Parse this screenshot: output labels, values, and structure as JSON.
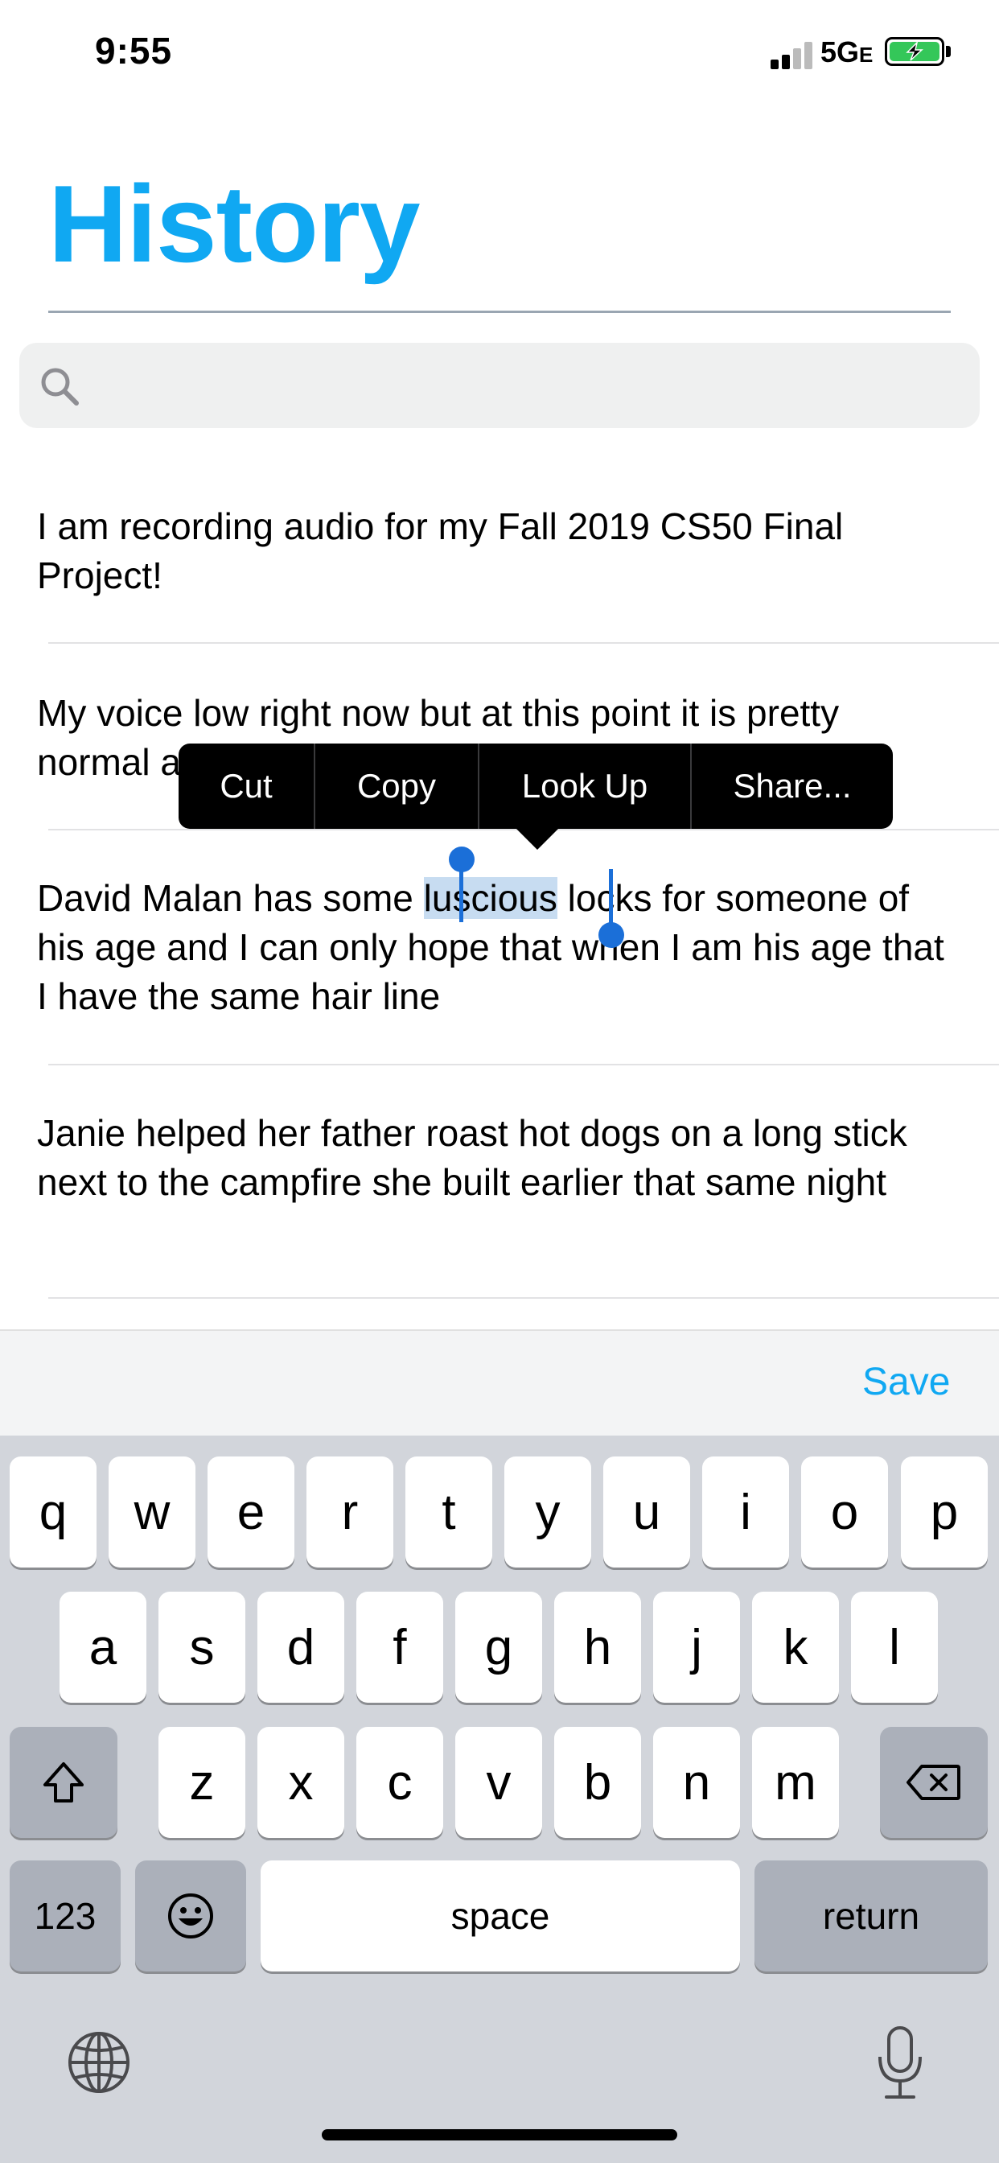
{
  "status_bar": {
    "time": "9:55",
    "network": "5G",
    "network_suffix": "E"
  },
  "header": {
    "title": "History"
  },
  "search": {
    "placeholder": ""
  },
  "entries": [
    {
      "text": "I am recording audio for my Fall 2019 CS50 Final Project!"
    },
    {
      "text": "My voice low right now but at this point it is pretty normal a"
    },
    {
      "before": "David Malan has some ",
      "selected": "luscious",
      "after": " locks for someone of his age and I can only hope that when I am his age that I have the same hair line"
    },
    {
      "text": "Janie helped her father roast hot dogs on a long stick next to the campfire she built earlier that same night"
    }
  ],
  "edit_menu": {
    "items": [
      "Cut",
      "Copy",
      "Look Up",
      "Share..."
    ]
  },
  "accessory": {
    "save_label": "Save"
  },
  "keyboard": {
    "row1": [
      "q",
      "w",
      "e",
      "r",
      "t",
      "y",
      "u",
      "i",
      "o",
      "p"
    ],
    "row2": [
      "a",
      "s",
      "d",
      "f",
      "g",
      "h",
      "j",
      "k",
      "l"
    ],
    "row3": [
      "z",
      "x",
      "c",
      "v",
      "b",
      "n",
      "m"
    ],
    "numbers_label": "123",
    "space_label": "space",
    "return_label": "return"
  },
  "icons": {
    "signal": "signal-bars-icon",
    "battery": "battery-charging-icon",
    "search": "search-icon",
    "shift": "shift-icon",
    "delete": "delete-icon",
    "emoji": "emoji-icon",
    "globe": "globe-icon",
    "mic": "microphone-icon"
  },
  "colors": {
    "accent": "#10a8f2",
    "selection": "#c7dcf1",
    "handle": "#1b6fd8",
    "battery": "#34c759"
  }
}
